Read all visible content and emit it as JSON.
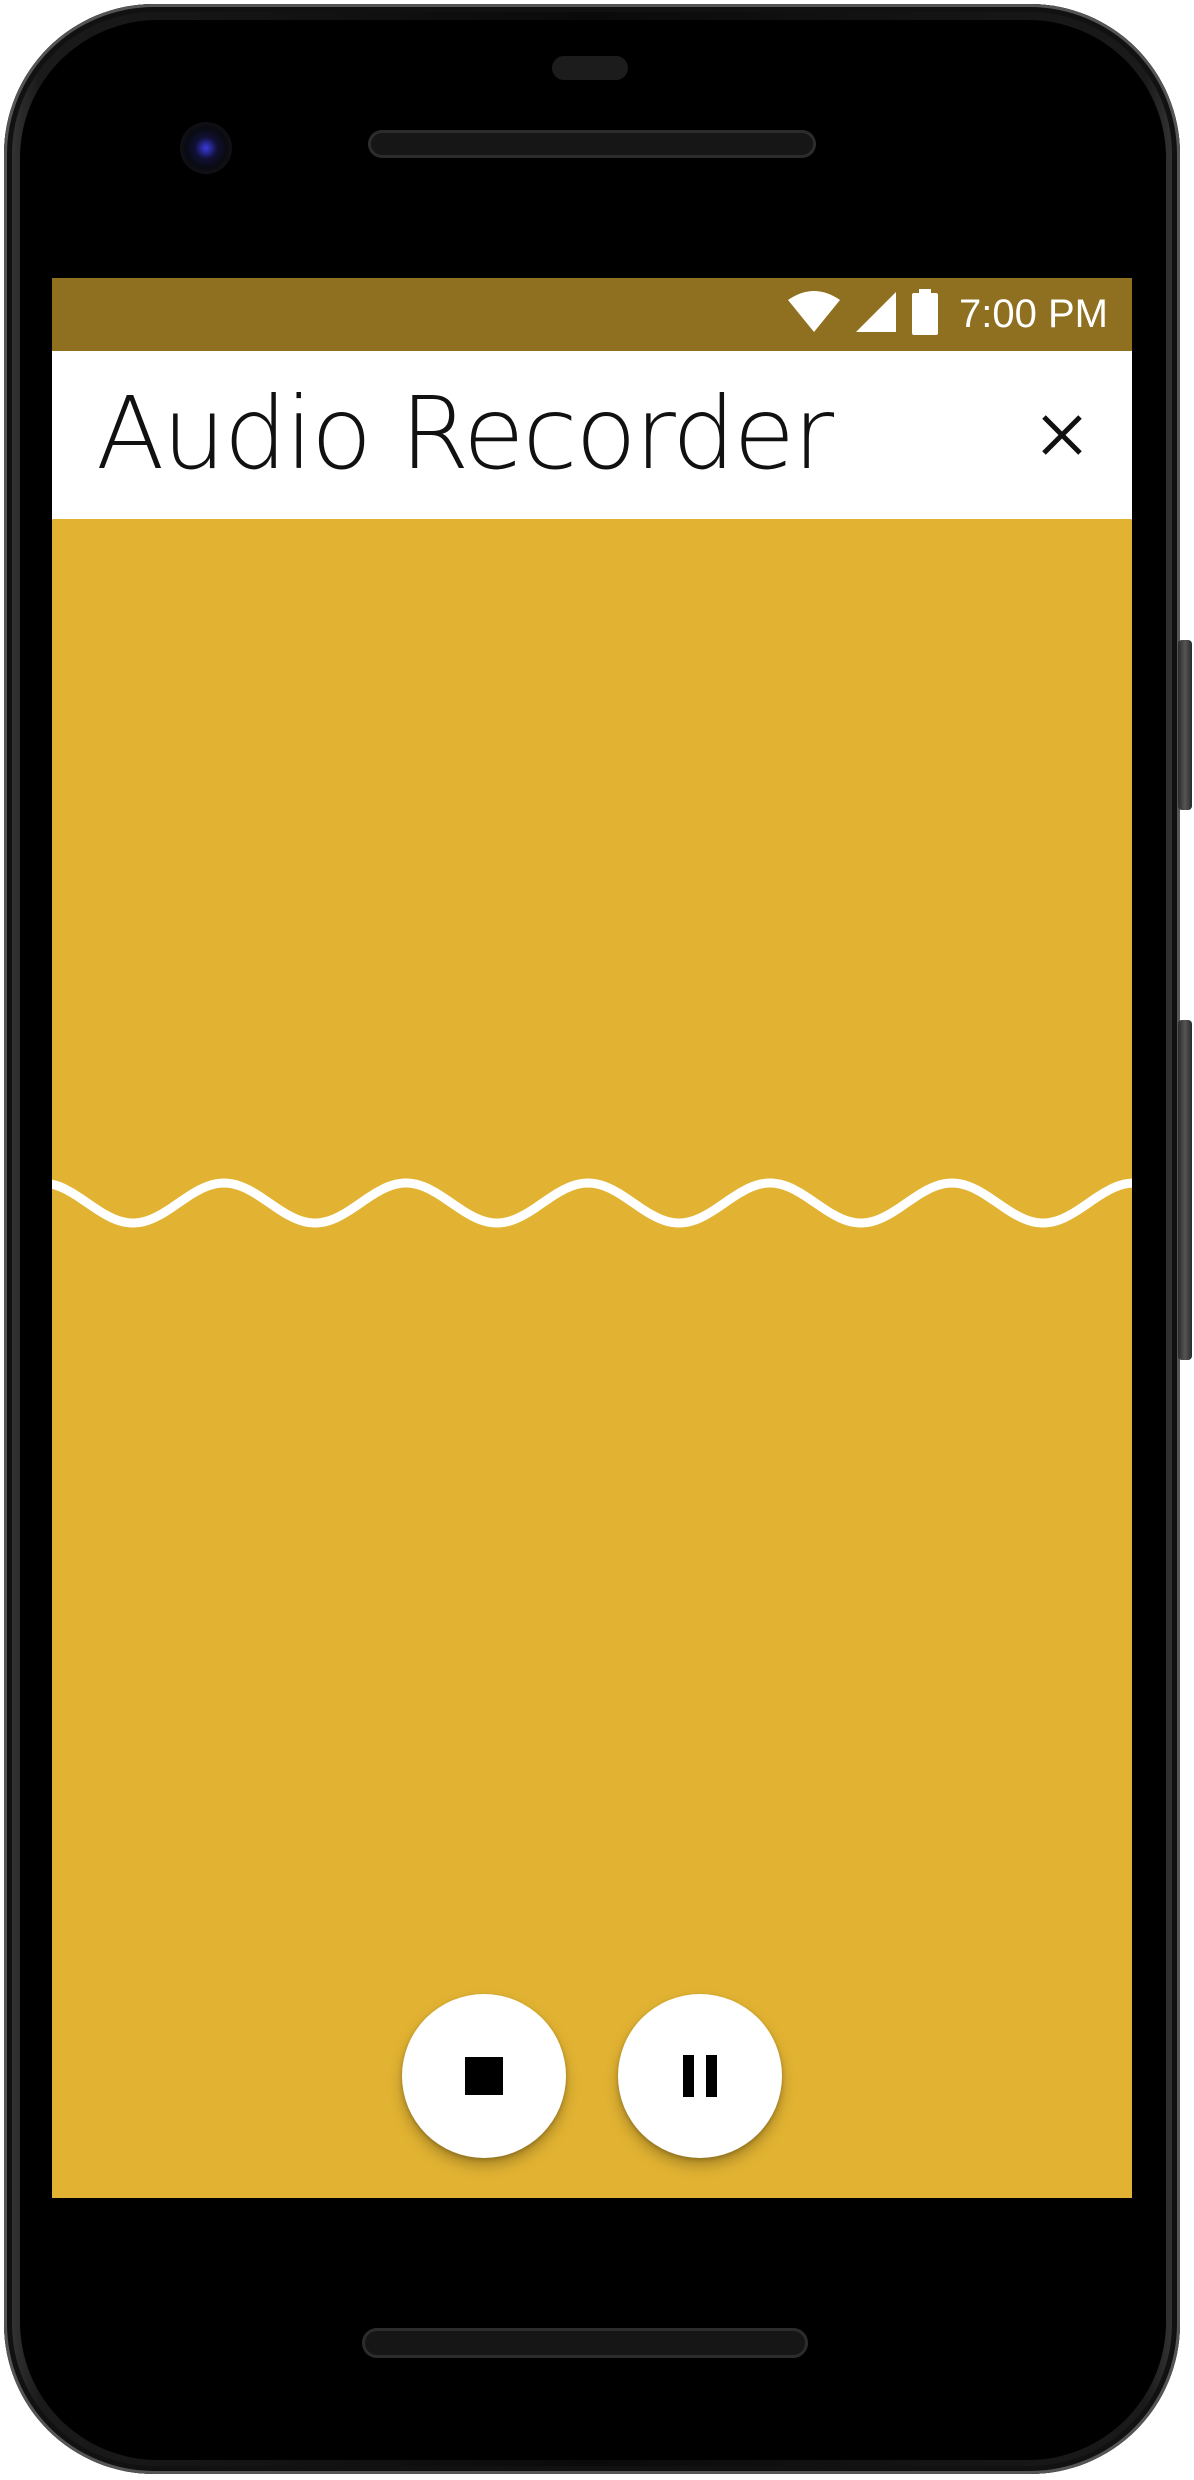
{
  "status_bar": {
    "time": "7:00 PM",
    "icons": [
      "wifi-icon",
      "cellular-signal-icon",
      "battery-icon"
    ],
    "color": "#8e7020"
  },
  "app_bar": {
    "title": "Audio Recorder",
    "close_icon": "close-icon"
  },
  "recorder": {
    "background_color": "#e2b332",
    "waveform_icon": "sine-wave",
    "controls": {
      "stop_icon": "stop-icon",
      "pause_icon": "pause-icon"
    }
  }
}
